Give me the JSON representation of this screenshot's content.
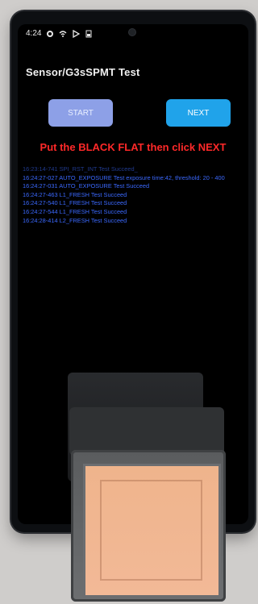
{
  "status": {
    "time": "4:24",
    "icons": [
      "gear-icon",
      "wifi-icon",
      "play-icon",
      "battery-icon"
    ]
  },
  "app": {
    "title": "Sensor/G3sSPMT Test"
  },
  "buttons": {
    "start": "START",
    "next": "NEXT"
  },
  "instruction": "Put the BLACK FLAT then click NEXT",
  "log": [
    "16:23:14-741 SPI_RST_INT Test  Succeed_",
    "16:24:27-027 AUTO_EXPOSURE Test exposure time:42, threshold: 20 - 400",
    "16:24:27-031 AUTO_EXPOSURE Test  Succeed",
    "16:24:27-463 L1_FRESH Test  Succeed",
    "16:24:27-540 L1_FRESH Test  Succeed",
    "16:24:27-544 L1_FRESH Test  Succeed",
    "16:24:28-414 L2_FRESH Test  Succeed"
  ],
  "colors": {
    "start_bg": "#8da0e7",
    "next_bg": "#20a3ea",
    "instruction": "#ff2929",
    "log": "#3b69ff"
  }
}
